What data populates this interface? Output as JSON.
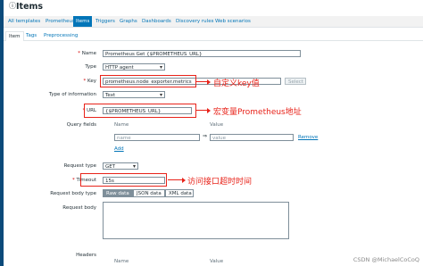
{
  "page": {
    "title": "Items"
  },
  "breadcrumb": [
    "All templates",
    "Prometheus",
    "Items",
    "Triggers",
    "Graphs",
    "Dashboards",
    "Discovery rules",
    "Web scenarios"
  ],
  "form_tabs": [
    "Item",
    "Tags",
    "Preprocessing"
  ],
  "fields": {
    "name": {
      "label": "Name",
      "value": "Prometheus Get {$PROMETHEUS_URL}"
    },
    "type": {
      "label": "Type",
      "value": "HTTP agent"
    },
    "key": {
      "label": "Key",
      "value": "prometheus.node_exporter.metrics",
      "select_label": "Select"
    },
    "type_of_information": {
      "label": "Type of information",
      "value": "Text"
    },
    "url": {
      "label": "URL",
      "value": "{$PROMETHEUS_URL}"
    },
    "query_fields": {
      "label": "Query fields",
      "col_name": "Name",
      "col_value": "Value",
      "name_placeholder": "name",
      "value_placeholder": "value",
      "eq": "⇒",
      "remove": "Remove",
      "add": "Add"
    },
    "request_type": {
      "label": "Request type",
      "value": "GET"
    },
    "timeout": {
      "label": "Timeout",
      "value": "15s"
    },
    "request_body_type": {
      "label": "Request body type",
      "options": [
        "Raw data",
        "JSON data",
        "XML data"
      ]
    },
    "request_body": {
      "label": "Request body"
    },
    "headers": {
      "label": "Headers",
      "col_name": "Name",
      "col_value": "Value"
    }
  },
  "annotations": {
    "key": "自定义key值",
    "url": "宏变量Prometheus地址",
    "timeout": "访问接口超时时间"
  },
  "watermark": "CSDN @MichaelCoCoQ",
  "colors": {
    "accent": "#0275b8",
    "annotation": "#e8231a",
    "sidebar": "#0b4a7a"
  }
}
